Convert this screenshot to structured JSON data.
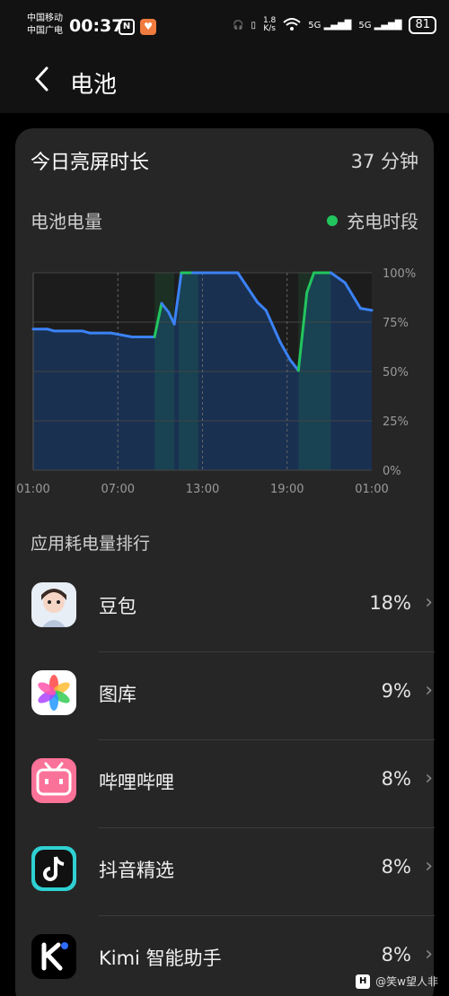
{
  "status_bar": {
    "carrier_1": "中国移动",
    "carrier_2": "中国广电",
    "time": "00:37",
    "net_speed_value": "1.8",
    "net_speed_unit": "K/s",
    "sim1": "5G",
    "sim2": "5G",
    "battery": "81"
  },
  "header": {
    "title": "电池"
  },
  "summary": {
    "label": "今日亮屏时长",
    "value": "37 分钟"
  },
  "battery_section": {
    "label": "电池电量",
    "legend": "充电时段"
  },
  "chart_data": {
    "type": "area",
    "x_ticks": [
      "01:00",
      "07:00",
      "13:00",
      "19:00",
      "01:00"
    ],
    "y_ticks": [
      "100%",
      "75%",
      "50%",
      "25%",
      "0%"
    ],
    "ylim": [
      0,
      100
    ],
    "x_range_hours": [
      0,
      24
    ],
    "series": [
      {
        "points": [
          [
            0,
            71.5
          ],
          [
            1,
            71.5
          ],
          [
            1.5,
            70.5
          ],
          [
            3.5,
            70.5
          ],
          [
            4,
            69.5
          ],
          [
            5.5,
            69.5
          ],
          [
            7,
            67.5
          ],
          [
            8.3,
            67.5
          ],
          [
            8.6,
            67.5
          ],
          [
            9.1,
            84.5
          ],
          [
            9.6,
            80
          ],
          [
            10,
            74
          ],
          [
            10.5,
            100
          ],
          [
            11.3,
            100
          ],
          [
            14.5,
            100
          ],
          [
            15.9,
            85
          ],
          [
            16.5,
            81
          ],
          [
            17.5,
            65
          ],
          [
            18.2,
            56
          ],
          [
            18.8,
            50.5
          ],
          [
            19.4,
            90
          ],
          [
            19.9,
            100
          ],
          [
            21.1,
            100
          ],
          [
            22.1,
            95
          ],
          [
            23.2,
            82
          ],
          [
            24,
            81
          ]
        ],
        "line_color": "#3b82f6",
        "fill_color": "#1a3358"
      }
    ],
    "charging_periods": [
      [
        8.6,
        10.0
      ],
      [
        10.3,
        11.7
      ],
      [
        18.8,
        21.1
      ]
    ],
    "charging_color": "#22c55e",
    "grid": true
  },
  "apps_section": {
    "label": "应用耗电量排行"
  },
  "apps": [
    {
      "name": "豆包",
      "percent": "18%",
      "icon": "doubao-icon"
    },
    {
      "name": "图库",
      "percent": "9%",
      "icon": "gallery-icon"
    },
    {
      "name": "哔哩哔哩",
      "percent": "8%",
      "icon": "bilibili-icon"
    },
    {
      "name": "抖音精选",
      "percent": "8%",
      "icon": "douyin-icon"
    },
    {
      "name": "Kimi 智能助手",
      "percent": "8%",
      "icon": "kimi-icon"
    }
  ],
  "watermark": {
    "logo": "H",
    "text": "@笑w望人非"
  }
}
